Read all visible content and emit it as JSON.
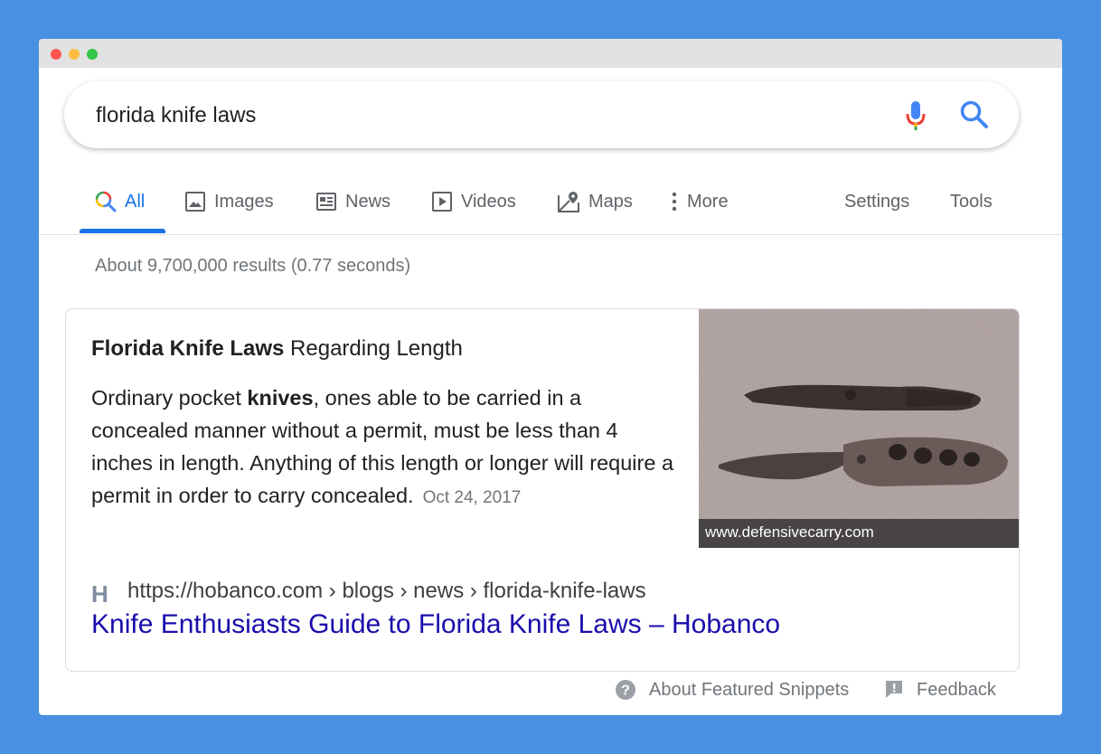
{
  "search": {
    "query": "florida knife laws"
  },
  "tabs": [
    {
      "label": "All",
      "icon": "search-icon"
    },
    {
      "label": "Images",
      "icon": "image-icon"
    },
    {
      "label": "News",
      "icon": "news-icon"
    },
    {
      "label": "Videos",
      "icon": "video-icon"
    },
    {
      "label": "Maps",
      "icon": "map-pin-icon"
    },
    {
      "label": "More",
      "icon": "kebab-icon"
    }
  ],
  "tools": {
    "settings": "Settings",
    "tools": "Tools"
  },
  "stats": "About 9,700,000 results (0.77 seconds)",
  "snippet": {
    "heading_bold": "Florida Knife Laws",
    "heading_rest": " Regarding Length",
    "body_pre": "Ordinary pocket ",
    "body_bold": "knives",
    "body_post": ", ones able to be carried in a concealed manner without a permit, must be less than 4 inches in length. Anything of this length or longer will require a permit in order to carry concealed.",
    "date": "Oct 24, 2017",
    "image_caption": "www.defensivecarry.com",
    "site_icon": "H",
    "breadcrumb": "https://hobanco.com › blogs › news › florida-knife-laws",
    "link_title": "Knife Enthusiasts Guide to Florida Knife Laws – Hobanco"
  },
  "footer": {
    "about": "About Featured Snippets",
    "feedback": "Feedback"
  },
  "colors": {
    "background": "#4a90e2",
    "accent": "#1a73e8",
    "link": "#1a0dab"
  }
}
